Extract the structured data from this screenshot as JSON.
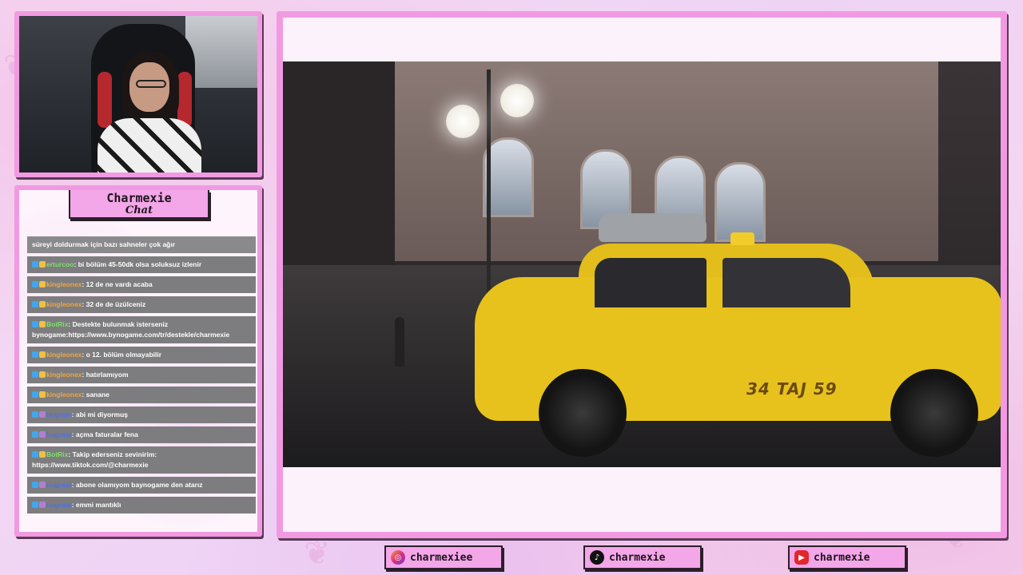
{
  "chat": {
    "title": "Charmexie",
    "subtitle": "Chat",
    "messages": [
      {
        "user": "",
        "text": "süreyi doldurmak için bazı sahneler çok ağır",
        "user_color": "#ffffff"
      },
      {
        "user": "erturcoo",
        "text": ": bi bölüm 45-50dk olsa soluksuz izlenir",
        "user_color": "#7fe06a"
      },
      {
        "user": "kingleonex",
        "text": ": 12 de ne vardı acaba",
        "user_color": "#f0a640"
      },
      {
        "user": "kingleonex",
        "text": ": 32 de de üzülceniz",
        "user_color": "#f0a640"
      },
      {
        "user": "BotRix",
        "text": ": Destekte bulunmak isterseniz bynogame:https://www.bynogame.com/tr/destekle/charmexie",
        "user_color": "#7fe06a"
      },
      {
        "user": "kingleonex",
        "text": ": o 12. bölüm olmayabilir",
        "user_color": "#f0a640"
      },
      {
        "user": "kingleonex",
        "text": ": hatırlamıyom",
        "user_color": "#f0a640"
      },
      {
        "user": "kingleonex",
        "text": ": sanane",
        "user_color": "#f0a640"
      },
      {
        "user": "bugrasr",
        "text": ": abi mi diyormuş",
        "user_color": "#4e6fe8"
      },
      {
        "user": "bugrasr",
        "text": ": açma faturalar fena",
        "user_color": "#4e6fe8"
      },
      {
        "user": "BotRix",
        "text": ": Takip ederseniz sevinirim: https://www.tiktok.com/@charmexie",
        "user_color": "#7fe06a"
      },
      {
        "user": "bugrasr",
        "text": ": abone olamıyom baynogame den atarız",
        "user_color": "#4e6fe8"
      },
      {
        "user": "bugrasr",
        "text": ": emmi mantıklı",
        "user_color": "#4e6fe8"
      }
    ]
  },
  "video": {
    "plate": "34 TAJ 59"
  },
  "socials": {
    "instagram": "charmexiee",
    "tiktok": "charmexie",
    "youtube": "charmexie"
  },
  "colors": {
    "frame": "#f19ae2",
    "label_bg": "#f3a6e8",
    "chat_bubble": "#7d7d7f"
  }
}
